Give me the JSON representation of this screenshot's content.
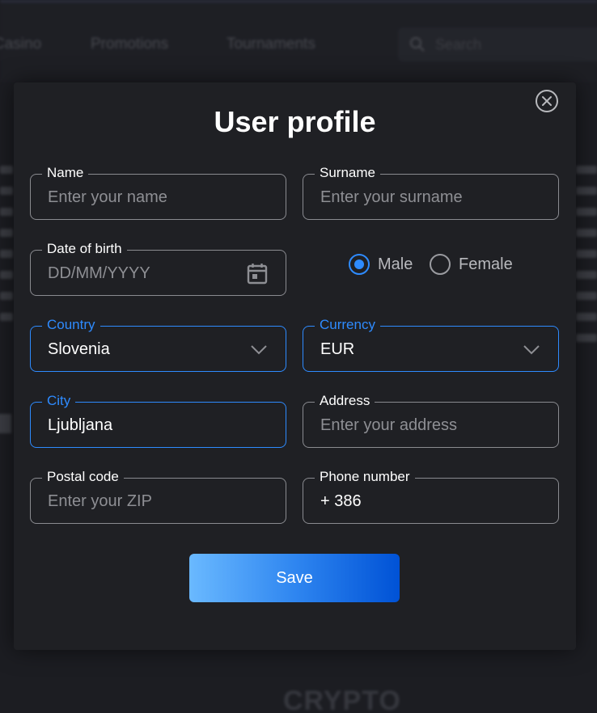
{
  "background": {
    "nav": [
      "Casino",
      "Promotions",
      "Tournaments"
    ],
    "search_placeholder": "Search",
    "bottom_heading": "CRYPTO"
  },
  "modal": {
    "title": "User profile",
    "close_icon": "close-circle-icon",
    "fields": {
      "name": {
        "label": "Name",
        "placeholder": "Enter your name"
      },
      "surname": {
        "label": "Surname",
        "placeholder": "Enter your surname"
      },
      "dob": {
        "label": "Date of birth",
        "placeholder": "DD/MM/YYYY",
        "icon": "calendar-icon"
      },
      "country": {
        "label": "Country",
        "value": "Slovenia",
        "icon": "chevron-down-icon"
      },
      "currency": {
        "label": "Currency",
        "value": "EUR",
        "icon": "chevron-down-icon"
      },
      "city": {
        "label": "City",
        "value": "Ljubljana"
      },
      "address": {
        "label": "Address",
        "placeholder": "Enter your address"
      },
      "postal": {
        "label": "Postal code",
        "placeholder": "Enter your ZIP"
      },
      "phone": {
        "label": "Phone number",
        "value": "+ 386"
      }
    },
    "gender": {
      "options": [
        "Male",
        "Female"
      ],
      "selected": "Male"
    },
    "save_label": "Save"
  },
  "colors": {
    "accent": "#2e8bff",
    "modal_bg": "#1f2024",
    "border": "#8a8b90",
    "placeholder": "#8e8f94",
    "text": "#ffffff"
  }
}
